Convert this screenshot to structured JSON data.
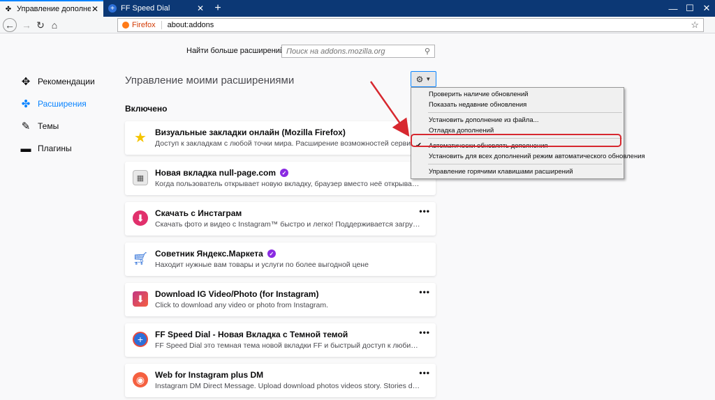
{
  "tabs": [
    {
      "label": "Управление дополнениями",
      "icon": "puzzle-icon",
      "active": true
    },
    {
      "label": "FF Speed Dial",
      "icon": "speed-dial-icon",
      "active": false
    }
  ],
  "urlbar": {
    "identity": "Firefox",
    "url": "about:addons"
  },
  "find_more": {
    "label": "Найти больше расширений",
    "placeholder": "Поиск на addons.mozilla.org"
  },
  "sidebar": {
    "items": [
      {
        "label": "Рекомендации",
        "icon": "recommendations-icon",
        "selected": false
      },
      {
        "label": "Расширения",
        "icon": "extensions-puzzle-icon",
        "selected": true
      },
      {
        "label": "Темы",
        "icon": "brush-icon",
        "selected": false
      },
      {
        "label": "Плагины",
        "icon": "plugin-icon",
        "selected": false
      }
    ]
  },
  "main": {
    "title": "Управление моими расширениями",
    "section": "Включено",
    "accent": "#0a84ff"
  },
  "extensions": [
    {
      "name": "Визуальные закладки онлайн (Mozilla Firefox)",
      "desc": "Доступ к закладкам с любой точки мира. Расширение возможностей сервиса Onlinez",
      "icon": "star-icon",
      "recommended": false
    },
    {
      "name": "Новая вкладка null-page.com",
      "desc": "Когда пользователь открывает новую вкладку, браузер вместо неё открывает сайт null...",
      "icon": "grid-page-icon",
      "recommended": true
    },
    {
      "name": "Скачать с Инстаграм",
      "desc": "Скачать фото и видео с Instagram™ быстро и легко! Поддерживается загрузка Историй...",
      "icon": "instagram-download-icon",
      "recommended": false
    },
    {
      "name": "Советник Яндекс.Маркета",
      "desc": "Находит нужные вам товары и услуги по более выгодной цене",
      "icon": "cart-icon",
      "recommended": true
    },
    {
      "name": "Download IG Video/Photo (for Instagram)",
      "desc": "Click to download any video or photo from Instagram.",
      "icon": "download-arrow-icon",
      "recommended": false
    },
    {
      "name": "FF Speed Dial - Новая Вкладка с Темной темой",
      "desc": "FF Speed Dial это темная тема новой вкладки FF и быстрый доступ к любимым сайтам. ...",
      "icon": "plus-circle-icon",
      "recommended": false
    },
    {
      "name": "Web for Instagram plus DM",
      "desc": "Instagram DM Direct Message. Upload download photos videos story. Stories downloader ...",
      "icon": "camera-icon",
      "recommended": false
    }
  ],
  "menu": {
    "items": [
      {
        "label": "Проверить наличие обновлений",
        "checked": false,
        "sep_after": false
      },
      {
        "label": "Показать недавние обновления",
        "checked": false,
        "sep_after": true
      },
      {
        "label": "Установить дополнение из файла...",
        "checked": false,
        "sep_after": false
      },
      {
        "label": "Отладка дополнений",
        "checked": false,
        "sep_after": true
      },
      {
        "label": "Автоматически обновлять дополнения",
        "checked": true,
        "sep_after": false
      },
      {
        "label": "Установить для всех дополнений режим автоматического обновления",
        "checked": false,
        "sep_after": true
      },
      {
        "label": "Управление горячими клавишами расширений",
        "checked": false,
        "sep_after": false
      }
    ]
  },
  "annotation_color": "#d7282f"
}
